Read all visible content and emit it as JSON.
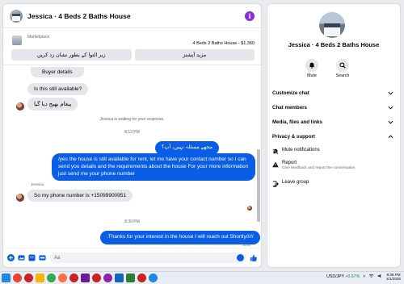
{
  "chat": {
    "title": "Jessica · 4 Beds 2 Baths House",
    "marketplace_label": "Marketplace",
    "listing_title": "4 Beds 2 Baths House - $1,360",
    "listing_actions": [
      "زیر التوا کے بطور نشان زد کریں",
      "مزید آپشنز"
    ],
    "messages": {
      "buyer_details": "Buyer details",
      "still_available": "Is this still available?",
      "urdu_sent": "پیغام بھیج دیا گیا",
      "waiting_note": "Jessica is waiting for your response.",
      "time1": "8:13 PM",
      "urdu_greeting": "مجھے مسئلہ نہیں، آپ؟",
      "long_reply": "/yes the house is still available for rent, let me have your contact number so I can send you details and the requirements about the house For your  more  information just  send  me   your  phone  number",
      "sender_name": "Jessica",
      "phone": "So my phone number is +15099900951",
      "time2": "8:39 PM",
      "thanks": ".Thanks for your interest in the house I will reach out Shortly/////",
      "sent": "Sent"
    },
    "composer_placeholder": "Aa"
  },
  "side": {
    "name": "Jessica · 4 Beds 2 Baths House",
    "actions": [
      "Mute",
      "Search"
    ],
    "sections": [
      "Customize chat",
      "Chat members",
      "Media, files and links",
      "Privacy & support"
    ],
    "privacy_items": {
      "mute": "Mute notifications",
      "report_title": "Report",
      "report_desc": "Give feedback and report the conversation",
      "leave": "Leave group"
    }
  },
  "taskbar": {
    "ticker_symbol": "USD/JPY",
    "ticker_change": "+0.57%",
    "time": "8:39 PM",
    "date": "2/1/2025"
  },
  "colors": {
    "accent": "#0a5ee6",
    "bubble_in": "#e4e6eb",
    "info": "#8a2be2"
  }
}
